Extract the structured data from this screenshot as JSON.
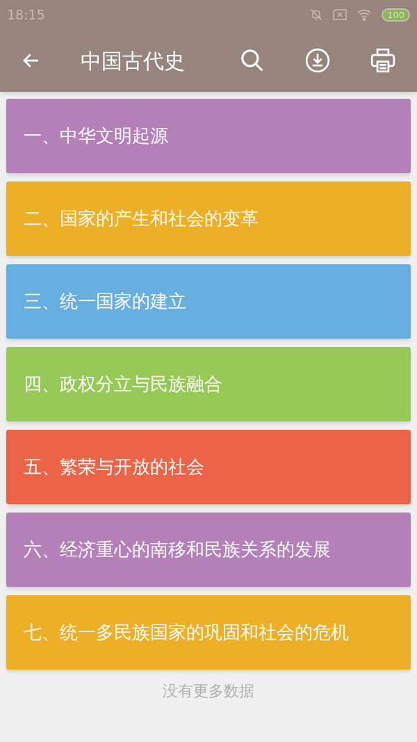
{
  "status_bar": {
    "time": "18:15",
    "battery": "100"
  },
  "toolbar": {
    "title": "中国古代史"
  },
  "chapters": [
    {
      "number": "一、",
      "title": "中华文明起源",
      "color": "#b381b8"
    },
    {
      "number": "二、",
      "title": "国家的产生和社会的变革",
      "color": "#edaf26"
    },
    {
      "number": "三、",
      "title": "统一国家的建立",
      "color": "#67afe0"
    },
    {
      "number": "四、",
      "title": "政权分立与民族融合",
      "color": "#97c957"
    },
    {
      "number": "五、",
      "title": "繁荣与开放的社会",
      "color": "#eb6448"
    },
    {
      "number": "六、",
      "title": "经济重心的南移和民族关系的发展",
      "color": "#b381b8"
    },
    {
      "number": "七、",
      "title": "统一多民族国家的巩固和社会的危机",
      "color": "#edaf26"
    }
  ],
  "footer": "没有更多数据"
}
